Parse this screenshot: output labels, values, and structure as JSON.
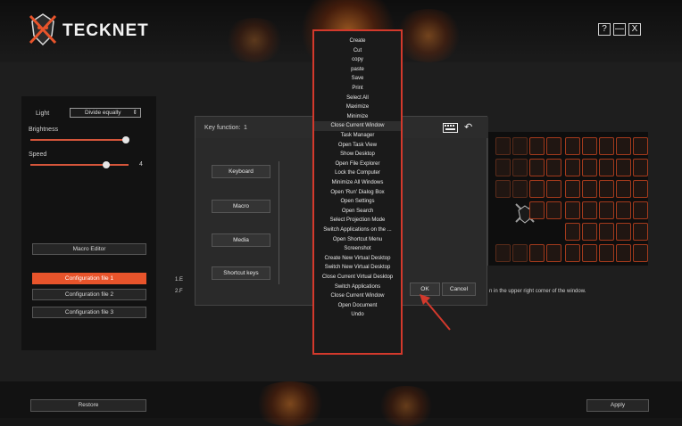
{
  "app": {
    "brand": "TECKNET",
    "window_buttons": [
      "?",
      "—",
      "X"
    ]
  },
  "left_panel": {
    "light_label": "Light",
    "light_mode": "Divide equally",
    "brightness_label": "Brightness",
    "speed_label": "Speed",
    "speed_value": "4",
    "brightness_level": 0.97,
    "speed_level": 0.77,
    "macro_editor": "Macro Editor",
    "configs": [
      "Configuration file 1",
      "Configuration file 2",
      "Configuration file 3"
    ]
  },
  "dialog": {
    "title": "Key function:",
    "key_number": "1",
    "tabs": [
      "Keyboard",
      "Macro",
      "Media",
      "Shortcut keys"
    ],
    "ok": "OK",
    "cancel": "Cancel"
  },
  "instructions": {
    "line1_prefix": "1.E",
    "line2_prefix": "2.F",
    "tail": "n in the upper right corner of the window."
  },
  "dropdown": {
    "selected_index": 9,
    "options": [
      "Create",
      "Cut",
      "copy",
      "paste",
      "Save",
      "Print",
      "Select All",
      "Maximize",
      "Minimize",
      "Close Current Window",
      "Task Manager",
      "Open Task View",
      "Show Desktop",
      "Open File Explorer",
      "Lock the Computer",
      "Minimize All Windows",
      "Open 'Run' Dialog Box",
      "Open Settings",
      "Open Search",
      "Select Projection Mode",
      "Switch Applications on the ...",
      "Open Shortcut Menu",
      "Screenshot",
      "Create New Virtual Desktop",
      "Switch  New Virtual Desktop",
      "Close Current Virtual Desktop",
      "Switch Applications",
      "Close Current Window",
      "Open Document",
      "Undo"
    ]
  },
  "footer": {
    "restore": "Restore",
    "apply": "Apply"
  },
  "colors": {
    "accent": "#e8542b",
    "highlight": "#d3392c"
  }
}
